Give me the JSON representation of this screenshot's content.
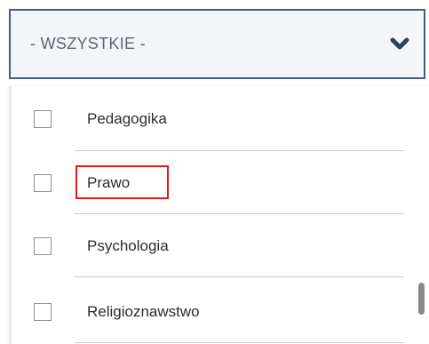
{
  "select": {
    "value": "- WSZYSTKIE -",
    "icon": "chevron-down-icon",
    "border_color": "#4a5a78",
    "chevron_color": "#2e3f63"
  },
  "options": [
    {
      "label": "Pedagogika",
      "checked": false
    },
    {
      "label": "Prawo",
      "checked": false,
      "highlighted": true
    },
    {
      "label": "Psychologia",
      "checked": false
    },
    {
      "label": "Religioznawstwo",
      "checked": false
    }
  ],
  "highlight_color": "#e01b1b"
}
